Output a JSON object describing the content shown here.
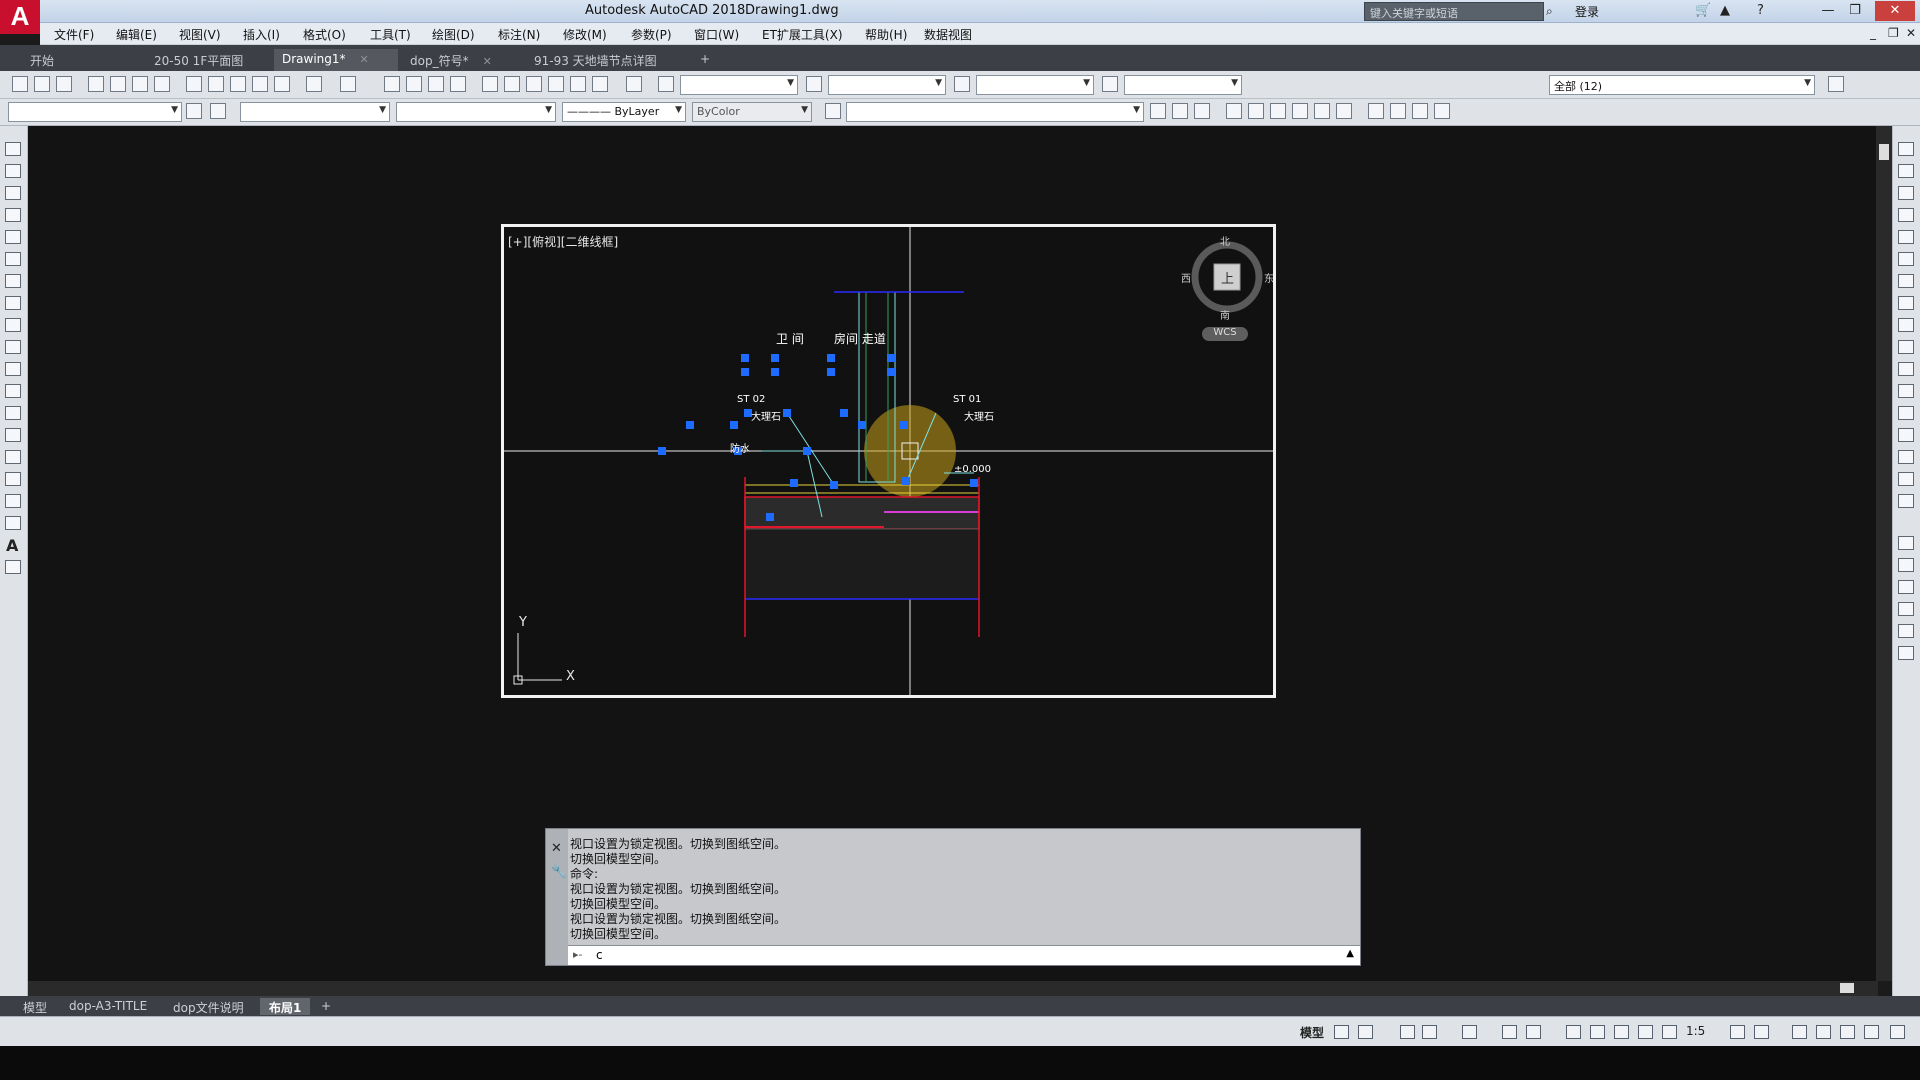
{
  "titlebar": {
    "app_title": "Autodesk AutoCAD 2018",
    "document": "Drawing1.dwg",
    "search_placeholder": "键入关键字或短语",
    "login": "登录"
  },
  "menu": [
    "文件(F)",
    "编辑(E)",
    "视图(V)",
    "插入(I)",
    "格式(O)",
    "工具(T)",
    "绘图(D)",
    "标注(N)",
    "修改(M)",
    "参数(P)",
    "窗口(W)",
    "ET扩展工具(X)",
    "帮助(H)",
    "数据视图"
  ],
  "doc_tabs": [
    "开始",
    "20-50 1F平面图*",
    "Drawing1*",
    "dop_符号*",
    "91-93 天地墙节点详图*"
  ],
  "active_doc_tab": "Drawing1*",
  "toolbar": {
    "linetype": "ByLayer",
    "lineweight": "ByColor",
    "layer_state": "全部 (12)"
  },
  "viewport": {
    "label": "[+][俯视][二维线框]",
    "viewcube": {
      "north": "北",
      "south": "南",
      "east": "东",
      "west": "西",
      "face": "上",
      "wcs": "WCS"
    },
    "ucs": {
      "x": "X",
      "y": "Y"
    },
    "annotations": {
      "room_left": "卫 间",
      "room_right": "房间 走道",
      "tag_left": "ST 02",
      "tag_right": "ST 01",
      "mat_left": "大理石",
      "mat_right": "大理石",
      "waterproof": "防水",
      "elevation": "±0.000"
    }
  },
  "command": {
    "lines": [
      "视口设置为锁定视图。切换到图纸空间。",
      "切换回模型空间。",
      "命令:",
      "视口设置为锁定视图。切换到图纸空间。",
      "切换回模型空间。",
      "视口设置为锁定视图。切换到图纸空间。",
      "切换回模型空间。"
    ],
    "input_value": "c"
  },
  "layout_tabs": [
    "模型",
    "dop-A3-TITLE",
    "dop文件说明",
    "布局1"
  ],
  "active_layout_tab": "布局1",
  "status": {
    "model_label": "模型",
    "scale": "1:5"
  },
  "colors": {
    "canvas_bg": "#131313",
    "grip_blue": "#1e6bff",
    "highlight_yellow": "#c9a21b",
    "line_red": "#e0162b",
    "line_cyan": "#7fe0e0"
  }
}
